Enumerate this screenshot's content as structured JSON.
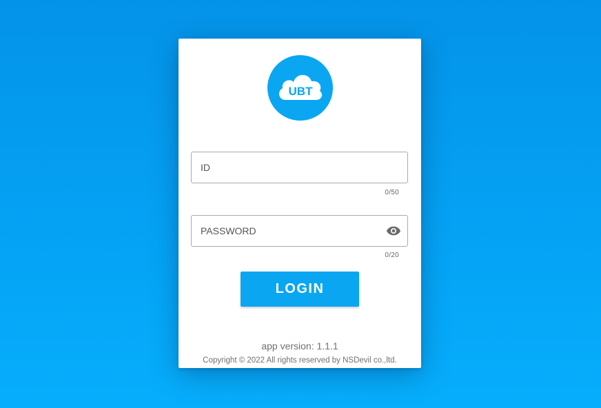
{
  "logo": {
    "text": "UBT",
    "icon": "cloud-icon",
    "background_color": "#0aa6f2"
  },
  "id_field": {
    "placeholder": "ID",
    "value": "",
    "counter": "0/50"
  },
  "password_field": {
    "placeholder": "PASSWORD",
    "value": "",
    "counter": "0/20",
    "toggle_icon": "eye-icon"
  },
  "login_button": {
    "label": "LOGIN",
    "color": "#0aa6f2"
  },
  "footer": {
    "version": "app version: 1.1.1",
    "copyright": "Copyright © 2022 All rights reserved by NSDevil co.,ltd."
  },
  "colors": {
    "background_top": "#0493e8",
    "background_bottom": "#06aefc",
    "card": "#ffffff"
  }
}
